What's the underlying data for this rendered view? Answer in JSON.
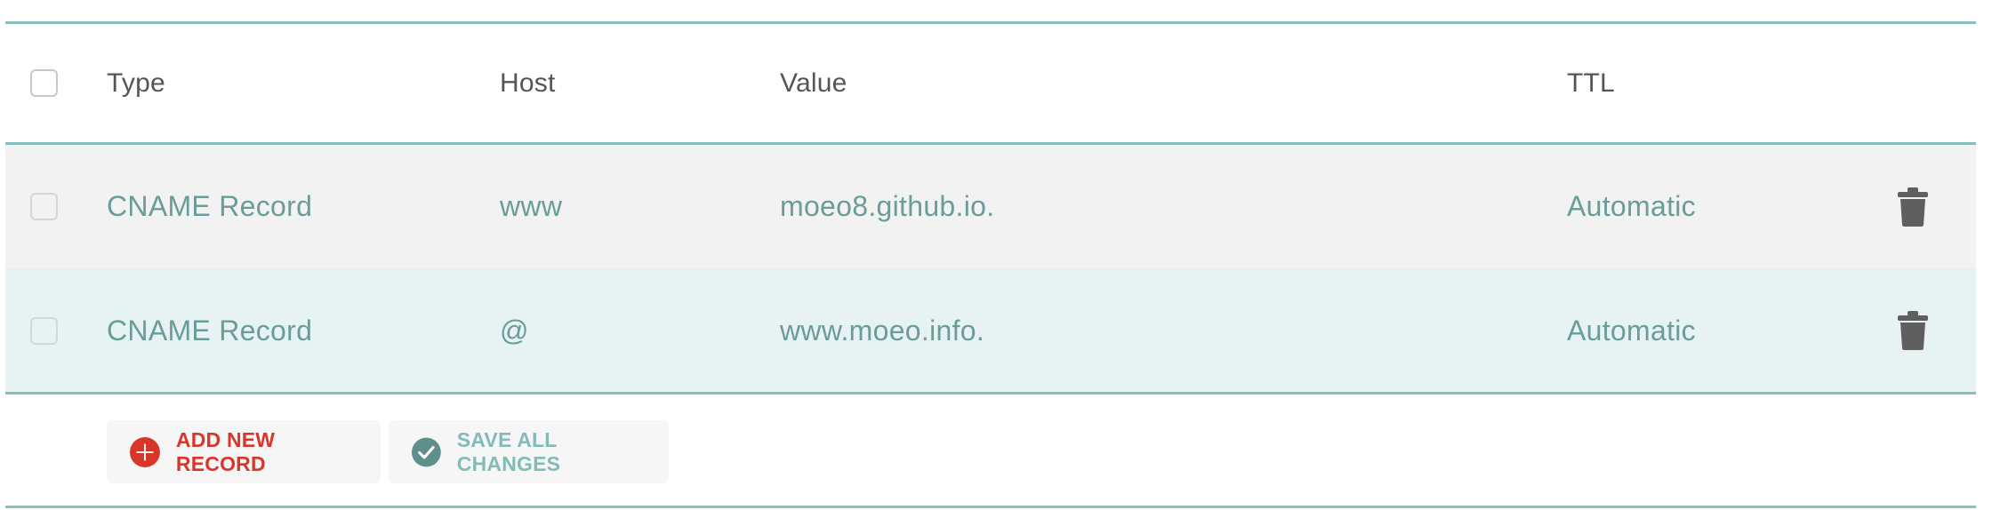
{
  "header": {
    "type_label": "Type",
    "host_label": "Host",
    "value_label": "Value",
    "ttl_label": "TTL"
  },
  "records": [
    {
      "type": "CNAME Record",
      "host": "www",
      "value": "moeo8.github.io.",
      "ttl": "Automatic"
    },
    {
      "type": "CNAME Record",
      "host": "@",
      "value": "www.moeo.info.",
      "ttl": "Automatic"
    }
  ],
  "actions": {
    "add_label": "ADD NEW RECORD",
    "save_label": "SAVE ALL CHANGES"
  },
  "icons": {
    "delete": "trash-icon",
    "add": "plus-circle-icon",
    "save": "check-circle-icon"
  },
  "colors": {
    "accent_line": "#86bfbe",
    "record_text": "#6a9c99",
    "add_red": "#d9362b",
    "save_teal": "#83bbb9",
    "check_circle": "#5e8f8b",
    "trash": "#5f5f5f"
  }
}
